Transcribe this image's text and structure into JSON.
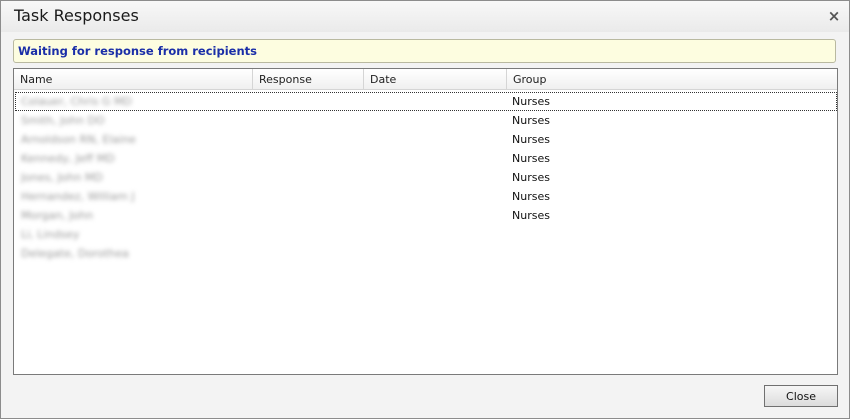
{
  "dialog": {
    "title": "Task Responses",
    "close_icon": "×",
    "status": "Waiting for response from recipients",
    "close_button_label": "Close"
  },
  "grid": {
    "columns": [
      {
        "label": "Name"
      },
      {
        "label": "Response"
      },
      {
        "label": "Date"
      },
      {
        "label": "Group"
      }
    ],
    "rows": [
      {
        "name": "Colauer, Chris G MD",
        "response": "",
        "date": "",
        "group": "Nurses"
      },
      {
        "name": "Smith, John DO",
        "response": "",
        "date": "",
        "group": "Nurses"
      },
      {
        "name": "Arnoldson RN, Elaine",
        "response": "",
        "date": "",
        "group": "Nurses"
      },
      {
        "name": "Kennedy, Jeff MD",
        "response": "",
        "date": "",
        "group": "Nurses"
      },
      {
        "name": "Jones, John MD",
        "response": "",
        "date": "",
        "group": "Nurses"
      },
      {
        "name": "Hernandez, William J",
        "response": "",
        "date": "",
        "group": "Nurses"
      },
      {
        "name": "Morgan, John",
        "response": "",
        "date": "",
        "group": "Nurses"
      },
      {
        "name": "Li, Lindsey",
        "response": "",
        "date": "",
        "group": ""
      },
      {
        "name": "Delegate, Dorothea",
        "response": "",
        "date": "",
        "group": ""
      }
    ]
  }
}
